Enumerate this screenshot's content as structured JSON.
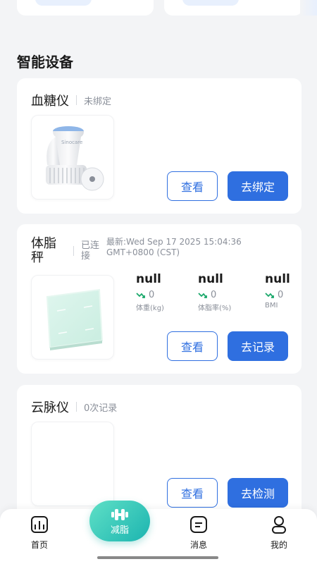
{
  "section_title": "智能设备",
  "devices": [
    {
      "name": "血糖仪",
      "status": "未绑定",
      "brand_text": "Sinocare",
      "view_label": "查看",
      "action_label": "去绑定"
    },
    {
      "name": "体脂秤",
      "status": "已连接",
      "latest": "最新:Wed Sep 17 2025 15:04:36 GMT+0800 (CST)",
      "stats": [
        {
          "value": "null",
          "delta": "0",
          "label": "体重(kg)"
        },
        {
          "value": "null",
          "delta": "0",
          "label": "体脂率(%)"
        },
        {
          "value": "null",
          "delta": "0",
          "label": "BMI"
        }
      ],
      "view_label": "查看",
      "action_label": "去记录"
    },
    {
      "name": "云脉仪",
      "status": "0次记录",
      "view_label": "查看",
      "action_label": "去检测"
    }
  ],
  "tabbar": {
    "home": "首页",
    "center": "减脂",
    "messages": "消息",
    "mine": "我的"
  },
  "colors": {
    "accent": "#2f6fe0",
    "trend_green": "#1aa86b",
    "center_tab": "#2cc3b5"
  }
}
